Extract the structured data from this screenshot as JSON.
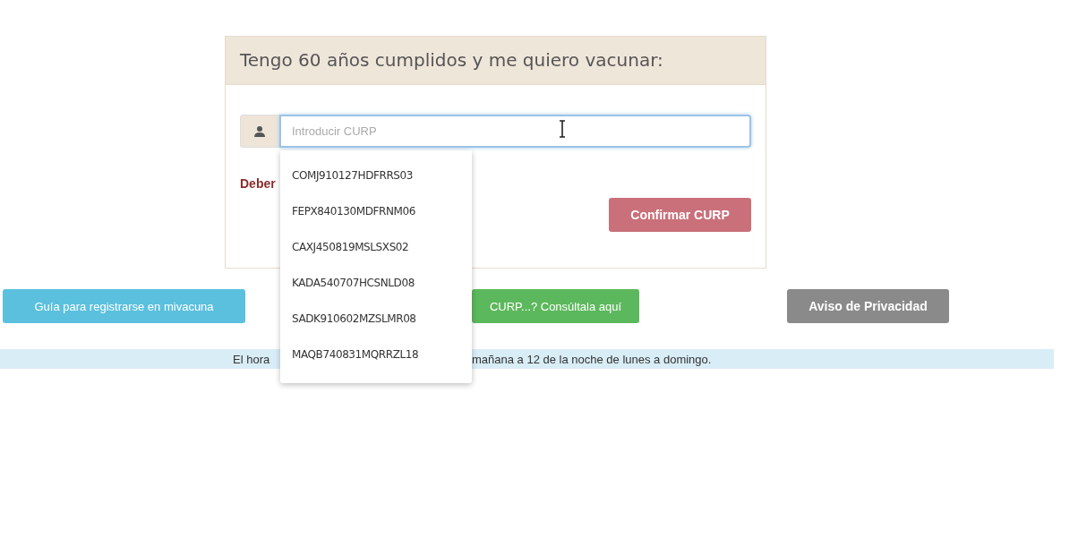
{
  "card": {
    "title": "Tengo 60 años cumplidos y me quiero vacunar:",
    "curp_field": {
      "placeholder": "Introducir CURP"
    },
    "warning": "Deber",
    "confirm_button": "Confirmar CURP"
  },
  "autocomplete": [
    "COMJ910127HDFRRS03",
    "FEPX840130MDFRNM06",
    "CAXJ450819MSLSXS02",
    "KADA540707HCSNLD08",
    "SADK910602MZSLMR08",
    "MAQB740831MQRRZL18"
  ],
  "buttons": [
    {
      "label": "Guía para registrarse en mivacuna",
      "kind": "info"
    },
    {
      "label": "CURP...? Consúltala aquí",
      "kind": "success"
    },
    {
      "label": "Aviso de Privacidad",
      "kind": "default"
    }
  ],
  "notice": [
    "El hora",
    "mañana a 12 de la noche de lunes a domingo."
  ]
}
